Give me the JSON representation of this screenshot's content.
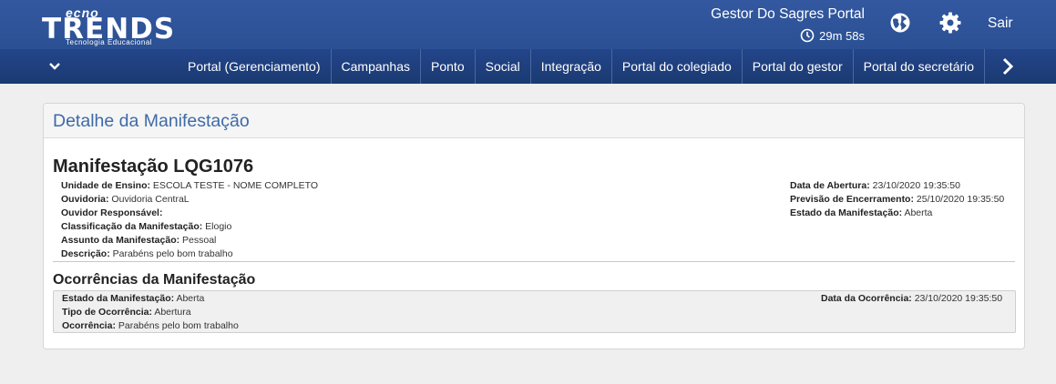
{
  "header": {
    "logo": {
      "top": "ecno",
      "main": "TRENDS",
      "tagline": "Tecnologia Educacional"
    },
    "user_name": "Gestor Do Sagres Portal",
    "timer": "29m 58s",
    "logout_label": "Sair"
  },
  "nav": {
    "items": [
      "Portal (Gerenciamento)",
      "Campanhas",
      "Ponto",
      "Social",
      "Integração",
      "Portal do colegiado",
      "Portal do gestor",
      "Portal do secretário"
    ]
  },
  "panel": {
    "title": "Detalhe da Manifestação",
    "manifest_title": "Manifestação LQG1076",
    "left_fields": [
      {
        "label": "Unidade de Ensino:",
        "value": " ESCOLA TESTE - NOME COMPLETO"
      },
      {
        "label": "Ouvidoria:",
        "value": " Ouvidoria CentraL"
      },
      {
        "label": "Ouvidor Responsável:",
        "value": ""
      },
      {
        "label": "Classificação da Manifestação:",
        "value": " Elogio"
      },
      {
        "label": "Assunto da Manifestação:",
        "value": " Pessoal"
      },
      {
        "label": "Descrição:",
        "value": " Parabéns pelo bom trabalho"
      }
    ],
    "right_fields": [
      {
        "label": "Data de Abertura:",
        "value": " 23/10/2020 19:35:50"
      },
      {
        "label": "Previsão de Encerramento:",
        "value": " 25/10/2020 19:35:50"
      },
      {
        "label": "Estado da Manifestação:",
        "value": " Aberta"
      }
    ],
    "occurrences_title": "Ocorrências da Manifestação",
    "occurrence": {
      "left_fields": [
        {
          "label": "Estado da Manifestação:",
          "value": " Aberta"
        },
        {
          "label": "Tipo de Ocorrência:",
          "value": " Abertura"
        },
        {
          "label": "Ocorrência:",
          "value": " Parabéns pelo bom trabalho"
        }
      ],
      "right_fields": [
        {
          "label": "Data da Ocorrência:",
          "value": " 23/10/2020 19:35:50"
        }
      ]
    }
  },
  "colors": {
    "header": "#2f5597",
    "nav": "#1e3f7a",
    "accent": "#3e6aa8"
  }
}
